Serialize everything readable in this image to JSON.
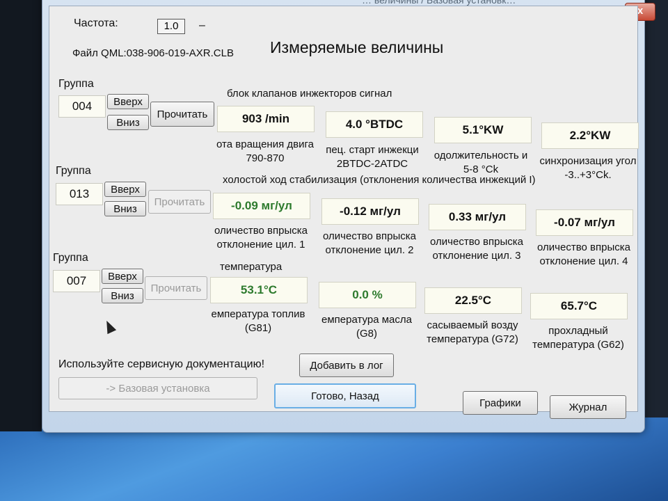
{
  "window": {
    "title_fragment": "… величины / Базовая установк…",
    "close_label": "x",
    "header_title": "Измеряемые величины"
  },
  "header": {
    "freq_label": "Частота:",
    "freq_value": "1.0",
    "freq_dash": "–",
    "file_label": "Файл QML:",
    "file_value": "038-906-019-AXR.CLB"
  },
  "groups": [
    {
      "label": "Группа",
      "number": "004",
      "up": "Вверх",
      "down": "Вниз",
      "read": "Прочитать",
      "name": "блок клапанов инжекторов сигнал",
      "cells": [
        {
          "value": "903 /min",
          "desc1": "ота вращения двига",
          "desc2": "790-870"
        },
        {
          "value": "4.0 °BTDC",
          "desc1": "пец. старт инжекци",
          "desc2": "2BTDC-2ATDC"
        },
        {
          "value": "5.1°KW",
          "desc1": "одолжительность и",
          "desc2": "5-8 °Ck"
        },
        {
          "value": "2.2°KW",
          "desc1": "синхронизация угол",
          "desc2": "-3..+3°Ck."
        }
      ]
    },
    {
      "label": "Группа",
      "number": "013",
      "up": "Вверх",
      "down": "Вниз",
      "read": "Прочитать",
      "name": "холостой ход стабилизация (отклонения количества инжекций I)",
      "cells": [
        {
          "value": "-0.09 мг/ул",
          "desc1": "оличество впрыска",
          "desc2": "отклонение цил. 1"
        },
        {
          "value": "-0.12 мг/ул",
          "desc1": "оличество впрыска",
          "desc2": "отклонение цил. 2"
        },
        {
          "value": "0.33 мг/ул",
          "desc1": "оличество впрыска",
          "desc2": "отклонение цил. 3"
        },
        {
          "value": "-0.07 мг/ул",
          "desc1": "оличество впрыска",
          "desc2": "отклонение цил. 4"
        }
      ]
    },
    {
      "label": "Группа",
      "number": "007",
      "up": "Вверх",
      "down": "Вниз",
      "read": "Прочитать",
      "name": "температура",
      "cells": [
        {
          "value": "53.1°C",
          "desc1": "емпература топлив",
          "desc2": "(G81)"
        },
        {
          "value": "0.0 %",
          "desc1": "емпература масла",
          "desc2": "(G8)"
        },
        {
          "value": "22.5°C",
          "desc1": "сасываемый возду",
          "desc2": "температура (G72)"
        },
        {
          "value": "65.7°C",
          "desc1": "прохладный",
          "desc2": "температура (G62)"
        }
      ]
    }
  ],
  "footer": {
    "hint": "Используйте сервисную документацию!",
    "add_log": "Добавить в лог",
    "basic_setup": "-> Базовая установка",
    "done_back": "Готово, Назад",
    "charts": "Графики",
    "journal": "Журнал"
  }
}
